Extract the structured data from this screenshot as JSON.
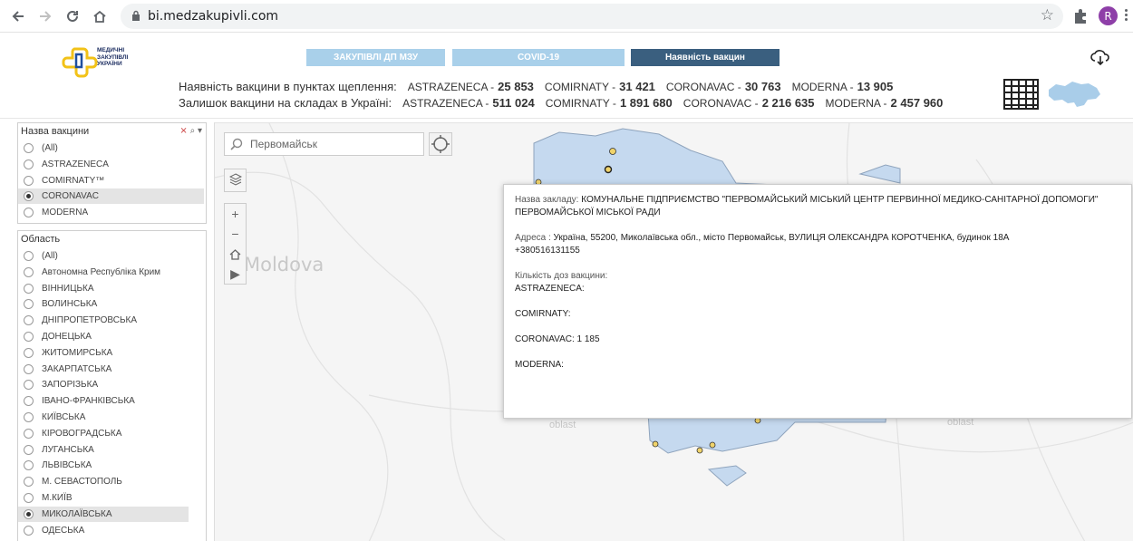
{
  "browser": {
    "url": "bi.medzakupivli.com",
    "profile_initial": "R"
  },
  "header": {
    "logo_text": [
      "МЕДИЧНІ",
      "ЗАКУПІВЛІ",
      "УКРАЇНИ"
    ],
    "tabs": [
      {
        "label": "ЗАКУПІВЛІ ДП МЗУ"
      },
      {
        "label": "COVID-19"
      },
      {
        "label": "Наявність вакцин"
      }
    ],
    "row1": {
      "label": "Наявність вакцини в пунктах щеплення:",
      "items": [
        {
          "name": "ASTRAZENECA -",
          "value": "25 853"
        },
        {
          "name": "COMIRNATY -",
          "value": "31 421"
        },
        {
          "name": "CORONAVAC -",
          "value": "30 763"
        },
        {
          "name": "MODERNA -",
          "value": "13 905"
        }
      ]
    },
    "row2": {
      "label": "Залишок вакцини на складах в Україні:",
      "items": [
        {
          "name": "ASTRAZENECA -",
          "value": "511 024"
        },
        {
          "name": "COMIRNATY -",
          "value": "1 891 680"
        },
        {
          "name": "CORONAVAC -",
          "value": "2 216 635"
        },
        {
          "name": "MODERNA -",
          "value": "2 457 960"
        }
      ]
    }
  },
  "vaccine_filter": {
    "title": "Назва вакцини",
    "options": [
      {
        "label": "(All)",
        "selected": false
      },
      {
        "label": "ASTRAZENECA",
        "selected": false
      },
      {
        "label": "COMIRNATY™",
        "selected": false
      },
      {
        "label": "CORONAVAC",
        "selected": true
      },
      {
        "label": "MODERNA",
        "selected": false
      }
    ]
  },
  "oblast_filter": {
    "title": "Область",
    "options": [
      {
        "label": "(All)",
        "selected": false
      },
      {
        "label": "Автономна Республіка Крим",
        "selected": false
      },
      {
        "label": "ВІННИЦЬКА",
        "selected": false
      },
      {
        "label": "ВОЛИНСЬКА",
        "selected": false
      },
      {
        "label": "ДНІПРОПЕТРОВСЬКА",
        "selected": false
      },
      {
        "label": "ДОНЕЦЬКА",
        "selected": false
      },
      {
        "label": "ЖИТОМИРСЬКА",
        "selected": false
      },
      {
        "label": "ЗАКАРПАТСЬКА",
        "selected": false
      },
      {
        "label": "ЗАПОРІЗЬКА",
        "selected": false
      },
      {
        "label": "ІВАНО-ФРАНКІВСЬКА",
        "selected": false
      },
      {
        "label": "КИЇВСЬКА",
        "selected": false
      },
      {
        "label": "КІРОВОГРАДСЬКА",
        "selected": false
      },
      {
        "label": "ЛУГАНСЬКА",
        "selected": false
      },
      {
        "label": "ЛЬВІВСЬКА",
        "selected": false
      },
      {
        "label": "М. СЕВАСТОПОЛЬ",
        "selected": false
      },
      {
        "label": "М.КИЇВ",
        "selected": false
      },
      {
        "label": "МИКОЛАЇВСЬКА",
        "selected": true
      },
      {
        "label": "ОДЕСЬКА",
        "selected": false
      }
    ]
  },
  "map": {
    "search_value": "Первомайськ",
    "labels": {
      "moldova": "Moldova",
      "oblast_left": "oblast",
      "oblast_right": "oblast"
    },
    "region_color": "#c5d9ef",
    "marker_color": "#f0d36a"
  },
  "popup": {
    "name_label": "Назва закладу:",
    "name_value": "КОМУНАЛЬНЕ ПІДПРИЄМСТВО \"ПЕРВОМАЙСЬКИЙ МІСЬКИЙ ЦЕНТР ПЕРВИННОЇ МЕДИКО-САНІТАРНОЇ ДОПОМОГИ\" ПЕРВОМАЙСЬКОЇ МІСЬКОЇ РАДИ",
    "address_label": "Адреса :",
    "address_value": "Україна, 55200, Миколаївська обл., місто Первомайськ, ВУЛИЦЯ ОЛЕКСАНДРА КОРОТЧЕНКА, будинок 18А",
    "phone": "+380516131155",
    "doses_label": "Кількість доз вакцини:",
    "doses": [
      {
        "label": "ASTRAZENECA:",
        "value": ""
      },
      {
        "label": "COMIRNATY:",
        "value": ""
      },
      {
        "label": "CORONAVAC:",
        "value": "1 185"
      },
      {
        "label": "MODERNA:",
        "value": ""
      }
    ]
  }
}
